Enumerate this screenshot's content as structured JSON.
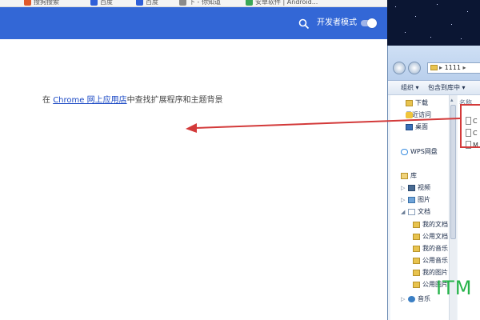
{
  "browser": {
    "bookmarks": [
      {
        "label": "搜狗搜索",
        "icon": "sogou-icon",
        "color": "#e05a2b"
      },
      {
        "label": "百度",
        "icon": "baidu-paw-icon",
        "color": "#2f5fd8"
      },
      {
        "label": "百度",
        "icon": "baidu-paw-icon",
        "color": "#2f5fd8"
      },
      {
        "label": "下 - 你知道",
        "icon": "page-icon",
        "color": "#8a8a8a"
      },
      {
        "label": "安卓软件 | Android...",
        "icon": "android-icon",
        "color": "#3aa757"
      }
    ],
    "header": {
      "search_icon": "search-icon",
      "dev_mode_label": "开发者模式",
      "dev_mode_enabled": false,
      "bg_color": "#3367d6"
    },
    "content": {
      "prefix": "在",
      "link": "Chrome 网上应用店",
      "suffix": "中查找扩展程序和主题背景"
    }
  },
  "explorer": {
    "address": "1111",
    "toolbar": {
      "organize": "组织 ▾",
      "include": "包含到库中 ▾"
    },
    "nav": {
      "favorites": [
        {
          "label": "下载",
          "icon": "download-folder-icon"
        },
        {
          "label": "最近访问",
          "icon": "recent-places-icon"
        },
        {
          "label": "桌面",
          "icon": "desktop-icon"
        }
      ],
      "cloud": {
        "label": "WPS网盘",
        "icon": "cloud-icon"
      },
      "library": {
        "label": "库",
        "icon": "library-icon"
      },
      "library_items": [
        {
          "label": "视频",
          "icon": "video-icon"
        },
        {
          "label": "图片",
          "icon": "picture-icon"
        },
        {
          "label": "文档",
          "icon": "document-icon"
        }
      ],
      "doc_subfolders": [
        "我的文档",
        "公用文档",
        "我的音乐",
        "公用音乐",
        "我的图片",
        "公用图片"
      ],
      "music": {
        "label": "音乐",
        "icon": "music-icon"
      }
    },
    "column_header": "名称",
    "files": [
      {
        "label": "C",
        "icon": "file-icon"
      },
      {
        "label": "C",
        "icon": "file-icon"
      },
      {
        "label": "M",
        "icon": "file-icon"
      }
    ]
  },
  "watermark": "ITM",
  "annotation": {
    "color": "#d33a3a"
  }
}
